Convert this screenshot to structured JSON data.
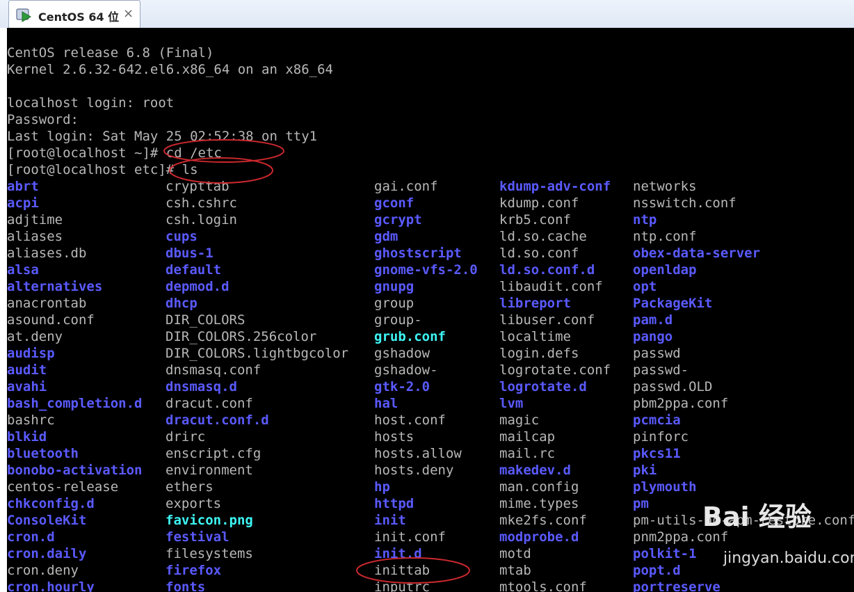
{
  "tab": {
    "title": "CentOS 64 位",
    "close_glyph": "×",
    "icon": "vm-play-icon"
  },
  "terminal": {
    "lines": [
      "CentOS release 6.8 (Final)",
      "Kernel 2.6.32-642.el6.x86_64 on an x86_64",
      "",
      "localhost login: root",
      "Password:",
      "Last login: Sat May 25 02:52:38 on tty1",
      "[root@localhost ~]# cd /etc",
      "[root@localhost etc]# ls"
    ],
    "columns": [
      [
        [
          "abrt",
          "d"
        ],
        [
          "acpi",
          "d"
        ],
        [
          "adjtime",
          "f"
        ],
        [
          "aliases",
          "f"
        ],
        [
          "aliases.db",
          "f"
        ],
        [
          "alsa",
          "d"
        ],
        [
          "alternatives",
          "d"
        ],
        [
          "anacrontab",
          "f"
        ],
        [
          "asound.conf",
          "f"
        ],
        [
          "at.deny",
          "f"
        ],
        [
          "audisp",
          "d"
        ],
        [
          "audit",
          "d"
        ],
        [
          "avahi",
          "d"
        ],
        [
          "bash_completion.d",
          "d"
        ],
        [
          "bashrc",
          "f"
        ],
        [
          "blkid",
          "d"
        ],
        [
          "bluetooth",
          "d"
        ],
        [
          "bonobo-activation",
          "d"
        ],
        [
          "centos-release",
          "f"
        ],
        [
          "chkconfig.d",
          "d"
        ],
        [
          "ConsoleKit",
          "d"
        ],
        [
          "cron.d",
          "d"
        ],
        [
          "cron.daily",
          "d"
        ],
        [
          "cron.deny",
          "f"
        ],
        [
          "cron.hourly",
          "d"
        ]
      ],
      [
        [
          "crypttab",
          "f"
        ],
        [
          "csh.cshrc",
          "f"
        ],
        [
          "csh.login",
          "f"
        ],
        [
          "cups",
          "d"
        ],
        [
          "dbus-1",
          "d"
        ],
        [
          "default",
          "d"
        ],
        [
          "depmod.d",
          "d"
        ],
        [
          "dhcp",
          "d"
        ],
        [
          "DIR_COLORS",
          "f"
        ],
        [
          "DIR_COLORS.256color",
          "f"
        ],
        [
          "DIR_COLORS.lightbgcolor",
          "f"
        ],
        [
          "dnsmasq.conf",
          "f"
        ],
        [
          "dnsmasq.d",
          "d"
        ],
        [
          "dracut.conf",
          "f"
        ],
        [
          "dracut.conf.d",
          "d"
        ],
        [
          "drirc",
          "f"
        ],
        [
          "enscript.cfg",
          "f"
        ],
        [
          "environment",
          "f"
        ],
        [
          "ethers",
          "f"
        ],
        [
          "exports",
          "f"
        ],
        [
          "favicon.png",
          "i"
        ],
        [
          "festival",
          "d"
        ],
        [
          "filesystems",
          "f"
        ],
        [
          "firefox",
          "d"
        ],
        [
          "fonts",
          "d"
        ]
      ],
      [
        [
          "gai.conf",
          "f"
        ],
        [
          "gconf",
          "d"
        ],
        [
          "gcrypt",
          "d"
        ],
        [
          "gdm",
          "d"
        ],
        [
          "ghostscript",
          "d"
        ],
        [
          "gnome-vfs-2.0",
          "d"
        ],
        [
          "gnupg",
          "d"
        ],
        [
          "group",
          "f"
        ],
        [
          "group-",
          "f"
        ],
        [
          "grub.conf",
          "i"
        ],
        [
          "gshadow",
          "f"
        ],
        [
          "gshadow-",
          "f"
        ],
        [
          "gtk-2.0",
          "d"
        ],
        [
          "hal",
          "d"
        ],
        [
          "host.conf",
          "f"
        ],
        [
          "hosts",
          "f"
        ],
        [
          "hosts.allow",
          "f"
        ],
        [
          "hosts.deny",
          "f"
        ],
        [
          "hp",
          "d"
        ],
        [
          "httpd",
          "d"
        ],
        [
          "init",
          "d"
        ],
        [
          "init.conf",
          "f"
        ],
        [
          "init.d",
          "d"
        ],
        [
          "inittab",
          "f"
        ],
        [
          "inputrc",
          "f"
        ]
      ],
      [
        [
          "kdump-adv-conf",
          "d"
        ],
        [
          "kdump.conf",
          "f"
        ],
        [
          "krb5.conf",
          "f"
        ],
        [
          "ld.so.cache",
          "f"
        ],
        [
          "ld.so.conf",
          "f"
        ],
        [
          "ld.so.conf.d",
          "d"
        ],
        [
          "libaudit.conf",
          "f"
        ],
        [
          "libreport",
          "d"
        ],
        [
          "libuser.conf",
          "f"
        ],
        [
          "localtime",
          "f"
        ],
        [
          "login.defs",
          "f"
        ],
        [
          "logrotate.conf",
          "f"
        ],
        [
          "logrotate.d",
          "d"
        ],
        [
          "lvm",
          "d"
        ],
        [
          "magic",
          "f"
        ],
        [
          "mailcap",
          "f"
        ],
        [
          "mail.rc",
          "f"
        ],
        [
          "makedev.d",
          "d"
        ],
        [
          "man.config",
          "f"
        ],
        [
          "mime.types",
          "f"
        ],
        [
          "mke2fs.conf",
          "f"
        ],
        [
          "modprobe.d",
          "d"
        ],
        [
          "motd",
          "f"
        ],
        [
          "mtab",
          "f"
        ],
        [
          "mtools.conf",
          "f"
        ]
      ],
      [
        [
          "networks",
          "f"
        ],
        [
          "nsswitch.conf",
          "f"
        ],
        [
          "ntp",
          "d"
        ],
        [
          "ntp.conf",
          "f"
        ],
        [
          "obex-data-server",
          "d"
        ],
        [
          "openldap",
          "d"
        ],
        [
          "opt",
          "d"
        ],
        [
          "PackageKit",
          "d"
        ],
        [
          "pam.d",
          "d"
        ],
        [
          "pango",
          "d"
        ],
        [
          "passwd",
          "f"
        ],
        [
          "passwd-",
          "f"
        ],
        [
          "passwd.OLD",
          "f"
        ],
        [
          "pbm2ppa.conf",
          "f"
        ],
        [
          "pcmcia",
          "d"
        ],
        [
          "pinforc",
          "f"
        ],
        [
          "pkcs11",
          "d"
        ],
        [
          "pki",
          "d"
        ],
        [
          "plymouth",
          "d"
        ],
        [
          "pm",
          "d"
        ],
        [
          "pm-utils-hd-apm-restore.conf",
          "f"
        ],
        [
          "pnm2ppa.conf",
          "f"
        ],
        [
          "polkit-1",
          "d"
        ],
        [
          "popt.d",
          "d"
        ],
        [
          "portreserve",
          "d"
        ]
      ]
    ],
    "colors": {
      "background": "#000000",
      "file": "#b8b8b8",
      "directory": "#5a5aff",
      "special": "#3ef5f5"
    }
  },
  "annotation_color": "#c8282d",
  "watermark": {
    "logo": "Bai 经验",
    "url": "jingyan.baidu.com"
  }
}
